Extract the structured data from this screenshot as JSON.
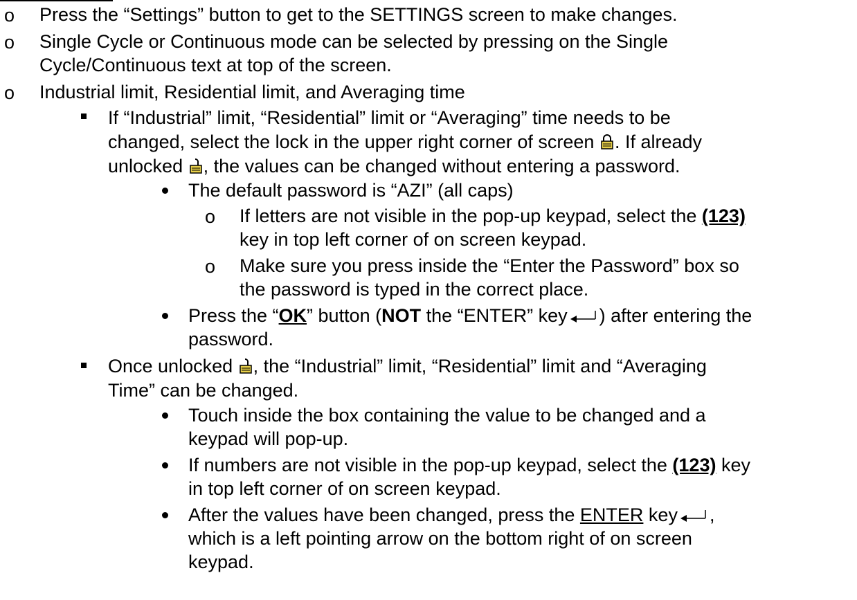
{
  "bullets": {
    "hollow": "o"
  },
  "icons": {
    "lock_closed": "lock-closed-icon",
    "lock_open": "lock-open-icon",
    "enter_key": "enter-arrow-icon"
  },
  "colors": {
    "lock_fill": "#e8d04a",
    "lock_body": "#c9a800"
  },
  "l1": "Press the “Settings” button to get to the SETTINGS screen to make changes.",
  "l2": "Single Cycle or Continuous mode can be selected by pressing on the Single",
  "l3": "Cycle/Continuous text at top of the screen.",
  "l4": "Industrial limit, Residential limit, and Averaging time",
  "l5": "If “Industrial” limit, “Residential” limit or “Averaging” time needs to be",
  "l6a": "changed, select the lock in the upper right corner of screen",
  "l6b": ". If already",
  "l7a": "unlocked",
  "l7b": ", the values can be changed without entering a password.",
  "l8": "The default password is “AZI” (all caps)",
  "l9a": "If letters are not visible in the pop-up keypad, select the",
  "l9b": "(123)",
  "l10": "key in top left corner of on screen keypad.",
  "l11": "Make sure you press inside the “Enter the Password” box so",
  "l12": "the password is typed in the correct place.",
  "l13a": "Press the “",
  "l13b": "OK",
  "l13c": "” button (",
  "l13d": "NOT",
  "l13e": " the “ENTER” key",
  "l13f": ") after entering the",
  "l14": "password.",
  "l15a": "Once unlocked",
  "l15b": ", the “Industrial” limit, “Residential” limit and “Averaging",
  "l16": "Time” can be changed.",
  "l17": "Touch inside the box containing the value to be changed and a",
  "l18": "keypad will pop-up.",
  "l19a": "If numbers are not visible in the pop-up keypad, select the",
  "l19b": "(123)",
  "l19c": " key",
  "l20": "in top left corner of on screen keypad.",
  "l21a": "After the values have been changed, press the",
  "l21b": "ENTER",
  "l21c": " key",
  "l21d": ",",
  "l22": "which is a left pointing arrow on the bottom right of on screen",
  "l23": "keypad."
}
